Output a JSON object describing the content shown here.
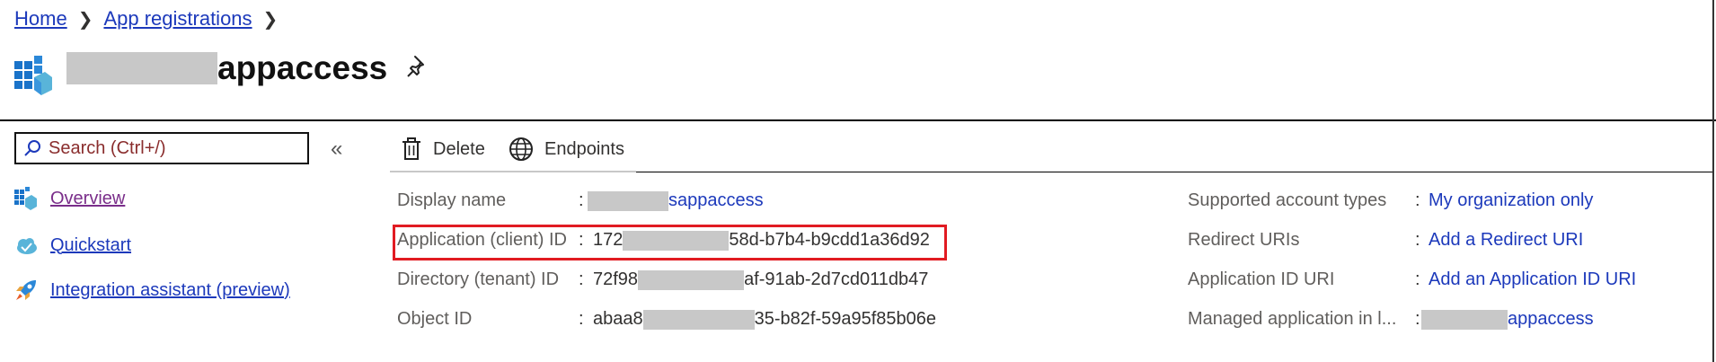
{
  "breadcrumb": {
    "home": "Home",
    "app_registrations": "App registrations"
  },
  "header": {
    "title_suffix": "appaccess",
    "pin_icon": "pin-icon"
  },
  "sidebar": {
    "search_placeholder": "Search (Ctrl+/)",
    "collapse_label": "«",
    "items": [
      {
        "label": "Overview",
        "icon": "overview-grid-icon",
        "color": "#7a2e8a"
      },
      {
        "label": "Quickstart",
        "icon": "cloud-quickstart-icon",
        "color": "#1c39bb"
      },
      {
        "label": "Integration assistant (preview)",
        "icon": "rocket-icon",
        "color": "#1c39bb"
      }
    ]
  },
  "commands": {
    "delete": "Delete",
    "endpoints": "Endpoints"
  },
  "essentials": {
    "left": [
      {
        "label": "Display name",
        "value_suffix": "sappaccess"
      },
      {
        "label": "Application (client) ID",
        "value_prefix": "172",
        "value_suffix": "58d-b7b4-b9cdd1a36d92"
      },
      {
        "label": "Directory (tenant) ID",
        "value_prefix": "72f98",
        "value_suffix": "af-91ab-2d7cd011db47"
      },
      {
        "label": "Object ID",
        "value_prefix": "abaa8",
        "value_suffix": "35-b82f-59a95f85b06e"
      }
    ],
    "right": [
      {
        "label": "Supported account types",
        "value": "My organization only"
      },
      {
        "label": "Redirect URIs",
        "value": "Add a Redirect URI"
      },
      {
        "label": "Application ID URI",
        "value": "Add an Application ID URI"
      },
      {
        "label": "Managed application in l...",
        "value_suffix": "appaccess"
      }
    ]
  },
  "colors": {
    "link": "#1c39bb",
    "highlight_border": "#e11b22",
    "redaction": "#c8c8c8"
  }
}
